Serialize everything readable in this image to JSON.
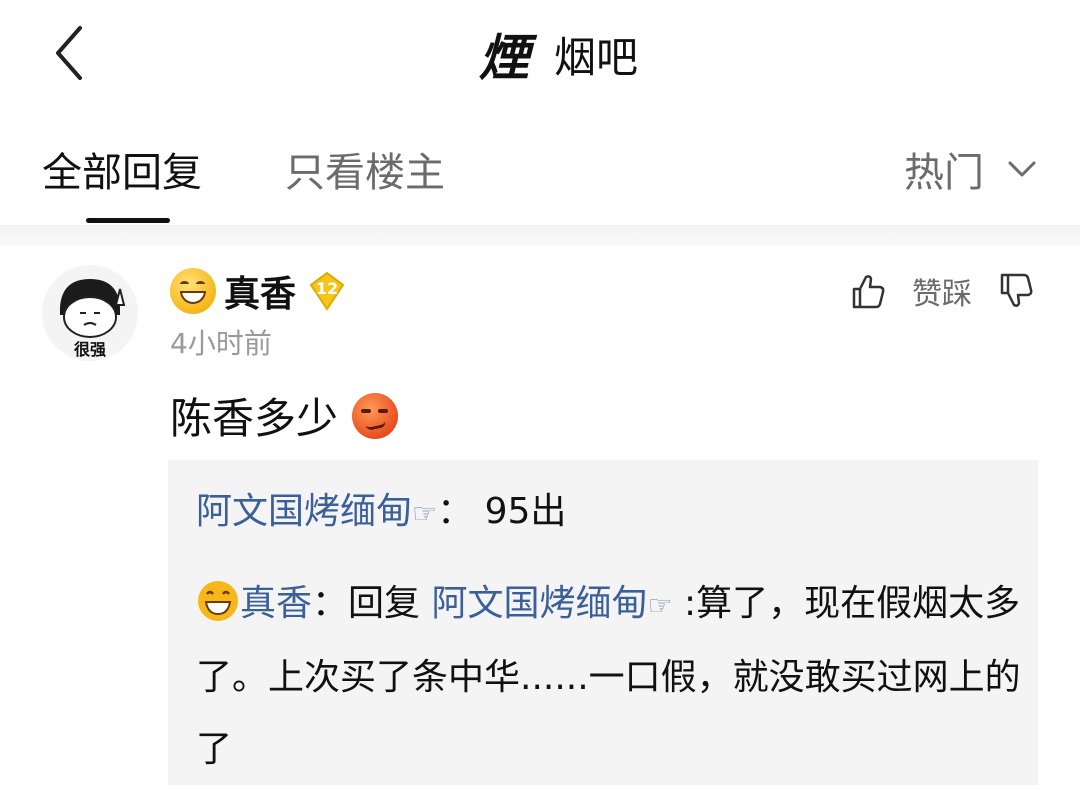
{
  "header": {
    "forum_logo_text": "煙",
    "forum_name": "烟吧"
  },
  "tabs": {
    "all_replies": "全部回复",
    "host_only": "只看楼主",
    "sort": "热门"
  },
  "post": {
    "username": "真香",
    "level": "12",
    "time": "4小时前",
    "content": "陈香多少",
    "vote_label": "赞踩",
    "avatar_caption": "很强"
  },
  "sub_replies": [
    {
      "author": "阿文国烤缅甸",
      "finger": "☞",
      "colon": "：",
      "text": "95出"
    },
    {
      "author": "真香",
      "colon": "：",
      "reply_prefix": "回复 ",
      "reply_to": "阿文国烤缅甸",
      "finger": "☞",
      "text": " :算了，现在假烟太多了。上次买了条中华......一口假，就没敢买过网上的了"
    }
  ],
  "colors": {
    "link": "#3a5f99",
    "level_badge": "#f5c518",
    "sub_bg": "#f4f4f4"
  },
  "icons": [
    "back-arrow-icon",
    "chevron-down-icon",
    "thumbs-up-icon",
    "thumbs-down-icon",
    "grin-emoji-icon",
    "smirk-emoji-icon",
    "level-badge-icon"
  ]
}
